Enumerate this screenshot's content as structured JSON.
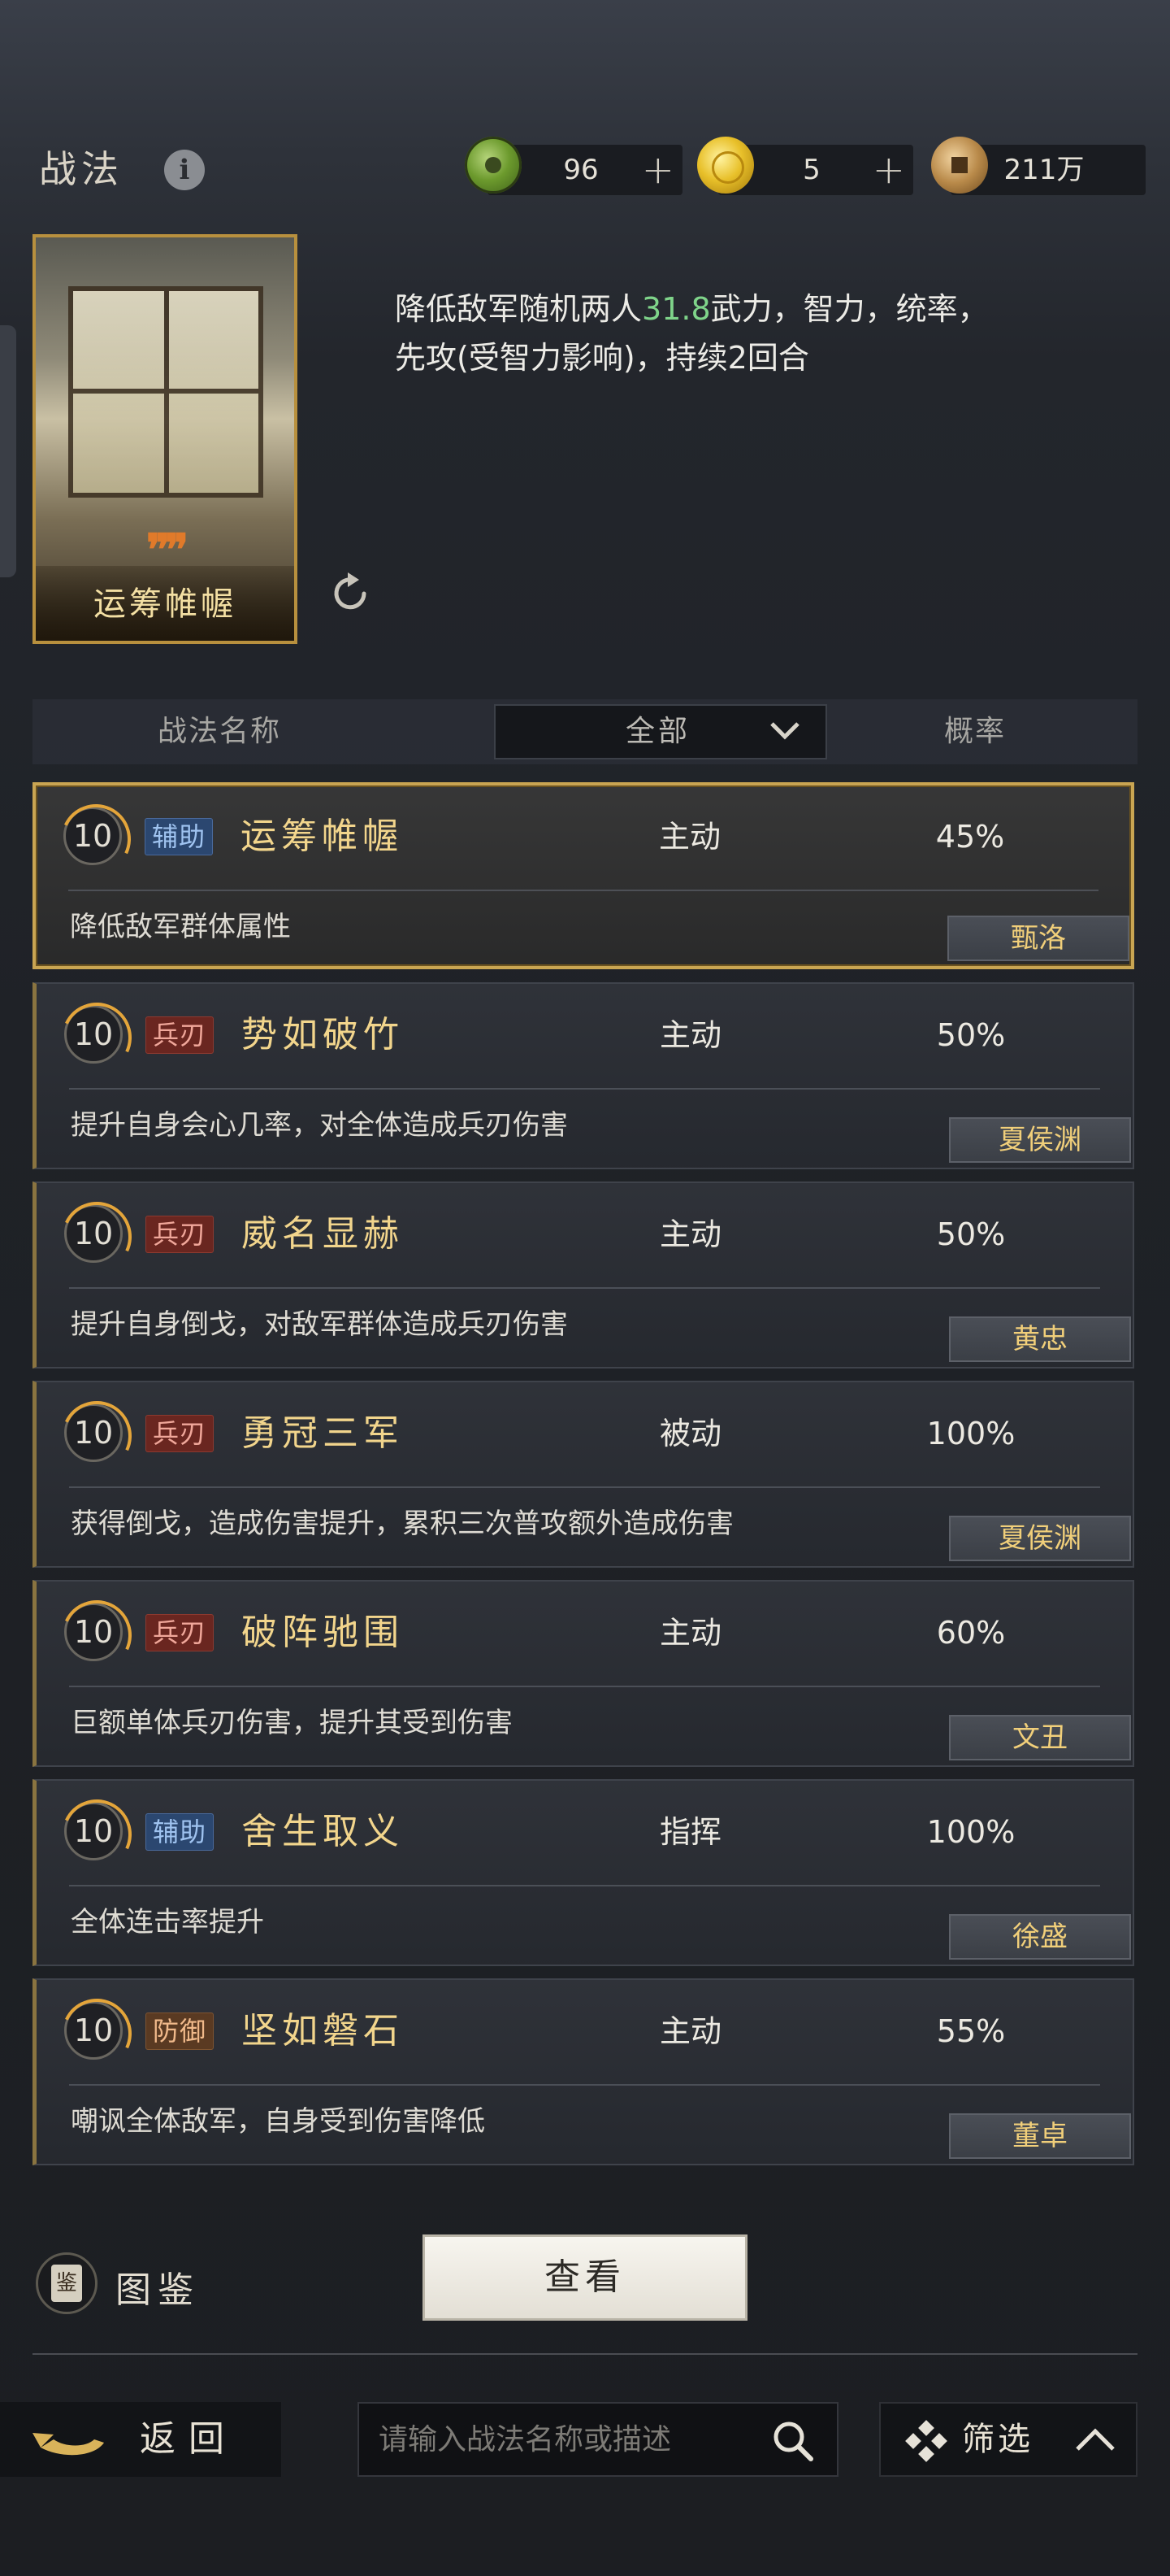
{
  "header": {
    "title": "战法",
    "resources": [
      {
        "icon": "jade-coin-icon",
        "value": "96",
        "has_plus": true
      },
      {
        "icon": "gold-coin-icon",
        "value": "5",
        "has_plus": true
      },
      {
        "icon": "copper-coin-icon",
        "value": "211万",
        "has_plus": false
      }
    ]
  },
  "selected_skill": {
    "card_name": "运筹帷幄",
    "desc_prefix": "降低敌军随机两人",
    "desc_highlight": "31.8",
    "desc_suffix": "武力，智力，统率，",
    "desc_line2": "先攻(受智力影响)，持续2回合"
  },
  "table": {
    "col_name": "战法名称",
    "filter_value": "全部",
    "col_rate": "概率"
  },
  "rows": [
    {
      "level": "10",
      "tag": "辅助",
      "name": "运筹帷幄",
      "type": "主动",
      "rate": "45%",
      "desc": "降低敌军群体属性",
      "hero": "甄洛"
    },
    {
      "level": "10",
      "tag": "兵刃",
      "name": "势如破竹",
      "type": "主动",
      "rate": "50%",
      "desc": "提升自身会心几率，对全体造成兵刃伤害",
      "hero": "夏侯渊"
    },
    {
      "level": "10",
      "tag": "兵刃",
      "name": "威名显赫",
      "type": "主动",
      "rate": "50%",
      "desc": "提升自身倒戈，对敌军群体造成兵刃伤害",
      "hero": "黄忠"
    },
    {
      "level": "10",
      "tag": "兵刃",
      "name": "勇冠三军",
      "type": "被动",
      "rate": "100%",
      "desc": "获得倒戈，造成伤害提升，累积三次普攻额外造成伤害",
      "hero": "夏侯渊"
    },
    {
      "level": "10",
      "tag": "兵刃",
      "name": "破阵驰围",
      "type": "主动",
      "rate": "60%",
      "desc": "巨额单体兵刃伤害，提升其受到伤害",
      "hero": "文丑"
    },
    {
      "level": "10",
      "tag": "辅助",
      "name": "舍生取义",
      "type": "指挥",
      "rate": "100%",
      "desc": "全体连击率提升",
      "hero": "徐盛"
    },
    {
      "level": "10",
      "tag": "防御",
      "name": "坚如磐石",
      "type": "主动",
      "rate": "55%",
      "desc": "嘲讽全体敌军，自身受到伤害降低",
      "hero": "董卓"
    }
  ],
  "bottom": {
    "atlas_icon_text": "鉴",
    "atlas_label": "图鉴",
    "view_button": "查看",
    "back_label": "返回",
    "search_placeholder": "请输入战法名称或描述",
    "filter_label": "筛选"
  },
  "colors": {
    "highlight": "#7fd48a",
    "skill_name": "#f2d58c",
    "hero_name": "#f1cf7a",
    "support_tag": "#2b4770",
    "blade_tag": "#6a2620",
    "defense_tag": "#5a3a22",
    "selected_border": "#c9a552"
  }
}
